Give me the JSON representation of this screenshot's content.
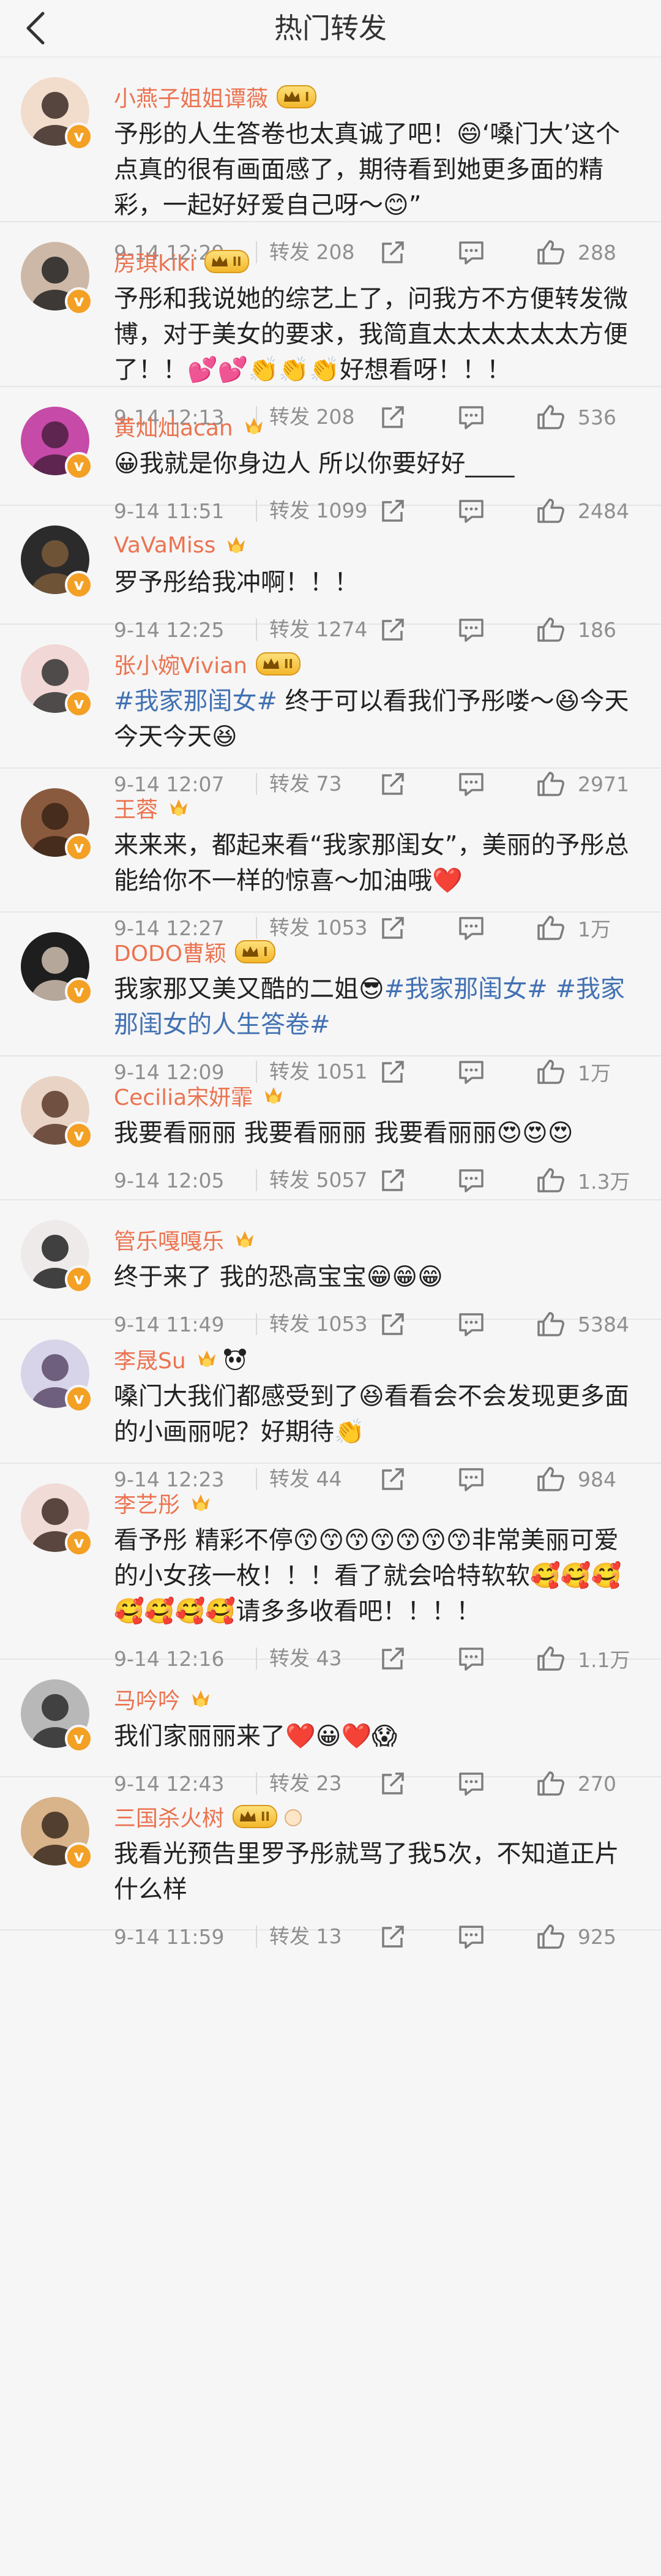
{
  "header": {
    "title": "热门转发"
  },
  "posts": [
    {
      "name": "小燕子姐姐谭薇",
      "vip": "I",
      "medals": [],
      "segments": [
        "予彤的人生答卷也太真诚了吧！",
        "😄",
        "‘嗓门大’这个点真的很有画面感了，期待看到她更多面的精彩，一起好好爱自己呀～",
        "😊",
        "”"
      ],
      "time": "9-14 12:29",
      "forward": "转发 208",
      "likes": "288"
    },
    {
      "name": "房琪kiki",
      "vip": "II",
      "medals": [],
      "segments": [
        "予彤和我说她的综艺上了，问我方不方便转发微博，对于美女的要求，我简直太太太太太太方便了！！",
        "💕💕👏👏👏",
        "好想看呀！！！"
      ],
      "time": "9-14 12:13",
      "forward": "转发 208",
      "likes": "536"
    },
    {
      "name": "黄灿灿acan",
      "vip": "",
      "medals": [
        "medal"
      ],
      "segments": [
        "😀",
        "我就是你身边人 所以你要好好____"
      ],
      "time": "9-14 11:51",
      "forward": "转发 1099",
      "likes": "2484"
    },
    {
      "name": "VaVaMiss",
      "vip": "",
      "medals": [
        "medal"
      ],
      "segments": [
        "罗予彤给我冲啊！！！"
      ],
      "time": "9-14 12:25",
      "forward": "转发 1274",
      "likes": "186"
    },
    {
      "name": "张小婉Vivian",
      "vip": "II",
      "medals": [],
      "segments": [
        "#我家那闺女#",
        " 终于可以看我们予彤喽～",
        "😆",
        "今天今天今天",
        "😆"
      ],
      "time": "9-14 12:07",
      "forward": "转发 73",
      "likes": "2971"
    },
    {
      "name": "王蓉",
      "vip": "",
      "medals": [
        "medal"
      ],
      "segments": [
        "来来来，都起来看“我家那闺女”，美丽的予彤总能给你不一样的惊喜～加油哦",
        "❤️"
      ],
      "time": "9-14 12:27",
      "forward": "转发 1053",
      "likes": "1万"
    },
    {
      "name": "DODO曹颖",
      "vip": "I",
      "medals": [],
      "segments": [
        "我家那又美又酷的二姐",
        "😎",
        "#我家那闺女#",
        " ",
        "#我家那闺女的人生答卷#"
      ],
      "time": "9-14 12:09",
      "forward": "转发 1051",
      "likes": "1万"
    },
    {
      "name": "Cecilia宋妍霏",
      "vip": "",
      "medals": [
        "medal"
      ],
      "segments": [
        "我要看丽丽 我要看丽丽 我要看丽丽",
        "😍😍😍"
      ],
      "time": "9-14 12:05",
      "forward": "转发 5057",
      "likes": "1.3万"
    },
    {
      "name": "管乐嘎嘎乐",
      "vip": "",
      "medals": [
        "medal"
      ],
      "segments": [
        "终于来了 我的恐高宝宝",
        "😁😁😁"
      ],
      "time": "9-14 11:49",
      "forward": "转发 1053",
      "likes": "5384"
    },
    {
      "name": "李晟Su",
      "vip": "",
      "medals": [
        "medal",
        "panda"
      ],
      "segments": [
        "嗓门大我们都感受到了",
        "😆",
        "看看会不会发现更多面的小画丽呢？好期待",
        "👏"
      ],
      "time": "9-14 12:23",
      "forward": "转发 44",
      "likes": "984"
    },
    {
      "name": "李艺彤",
      "vip": "",
      "medals": [
        "medal"
      ],
      "segments": [
        "看予彤 精彩不停",
        "😙😙😙😙😙😙😙",
        "非常美丽可爱的小女孩一枚！！！看了就会哈特软软",
        "🥰🥰🥰🥰🥰🥰🥰",
        "请多多收看吧！！！！"
      ],
      "time": "9-14 12:16",
      "forward": "转发 43",
      "likes": "1.1万"
    },
    {
      "name": "马吟吟",
      "vip": "",
      "medals": [
        "medal"
      ],
      "segments": [
        "我们家丽丽来了",
        "❤️😀❤️😱"
      ],
      "time": "9-14 12:43",
      "forward": "转发 23",
      "likes": "270"
    },
    {
      "name": "三国杀火树",
      "vip": "II",
      "medals": [
        "hand"
      ],
      "segments": [
        "我看光预告里罗予彤就骂了我5次，不知道正片什么样"
      ],
      "time": "9-14 11:59",
      "forward": "转发 13",
      "likes": "925"
    }
  ],
  "colors": {
    "name": "#eb7350",
    "hashtag": "#4271b3",
    "meta": "#8f8f8f",
    "badge": "#f3a024"
  },
  "icons": {
    "back": "chevron-left-icon",
    "share": "share-icon",
    "comment": "comment-icon",
    "like": "thumbs-up-icon",
    "verified": "verified-v-icon"
  }
}
